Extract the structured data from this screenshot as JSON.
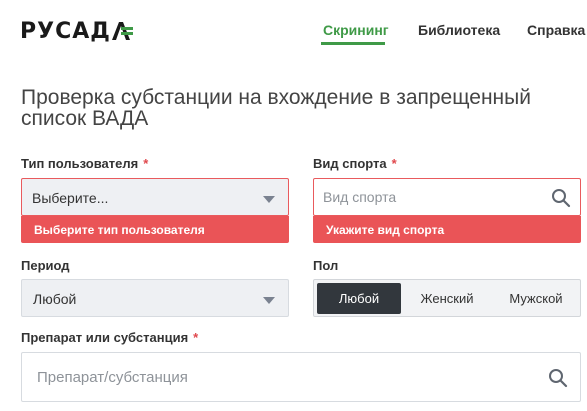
{
  "brand": {
    "logo_text": "РУСАД",
    "accent": "#3f9a47"
  },
  "nav": {
    "items": [
      {
        "label": "Скрининг",
        "active": true
      },
      {
        "label": "Библиотека",
        "active": false
      },
      {
        "label": "Справка",
        "active": false
      }
    ]
  },
  "page": {
    "title": "Проверка субстанции на вхождение в запрещенный список ВАДА"
  },
  "form": {
    "user_type": {
      "label": "Тип пользователя",
      "required_mark": "*",
      "value": "Выберите...",
      "error": "Выберите тип пользователя"
    },
    "sport": {
      "label": "Вид спорта",
      "required_mark": "*",
      "placeholder": "Вид спорта",
      "error": "Укажите вид спорта"
    },
    "period": {
      "label": "Период",
      "value": "Любой"
    },
    "gender": {
      "label": "Пол",
      "options": [
        {
          "label": "Любой",
          "selected": true
        },
        {
          "label": "Женский",
          "selected": false
        },
        {
          "label": "Мужской",
          "selected": false
        }
      ]
    },
    "substance": {
      "label": "Препарат или субстанция",
      "required_mark": "*",
      "placeholder": "Препарат/субстанция"
    }
  },
  "colors": {
    "error": "#ea5457",
    "active_segment": "#32373d",
    "select_bg": "#eef0f3"
  }
}
